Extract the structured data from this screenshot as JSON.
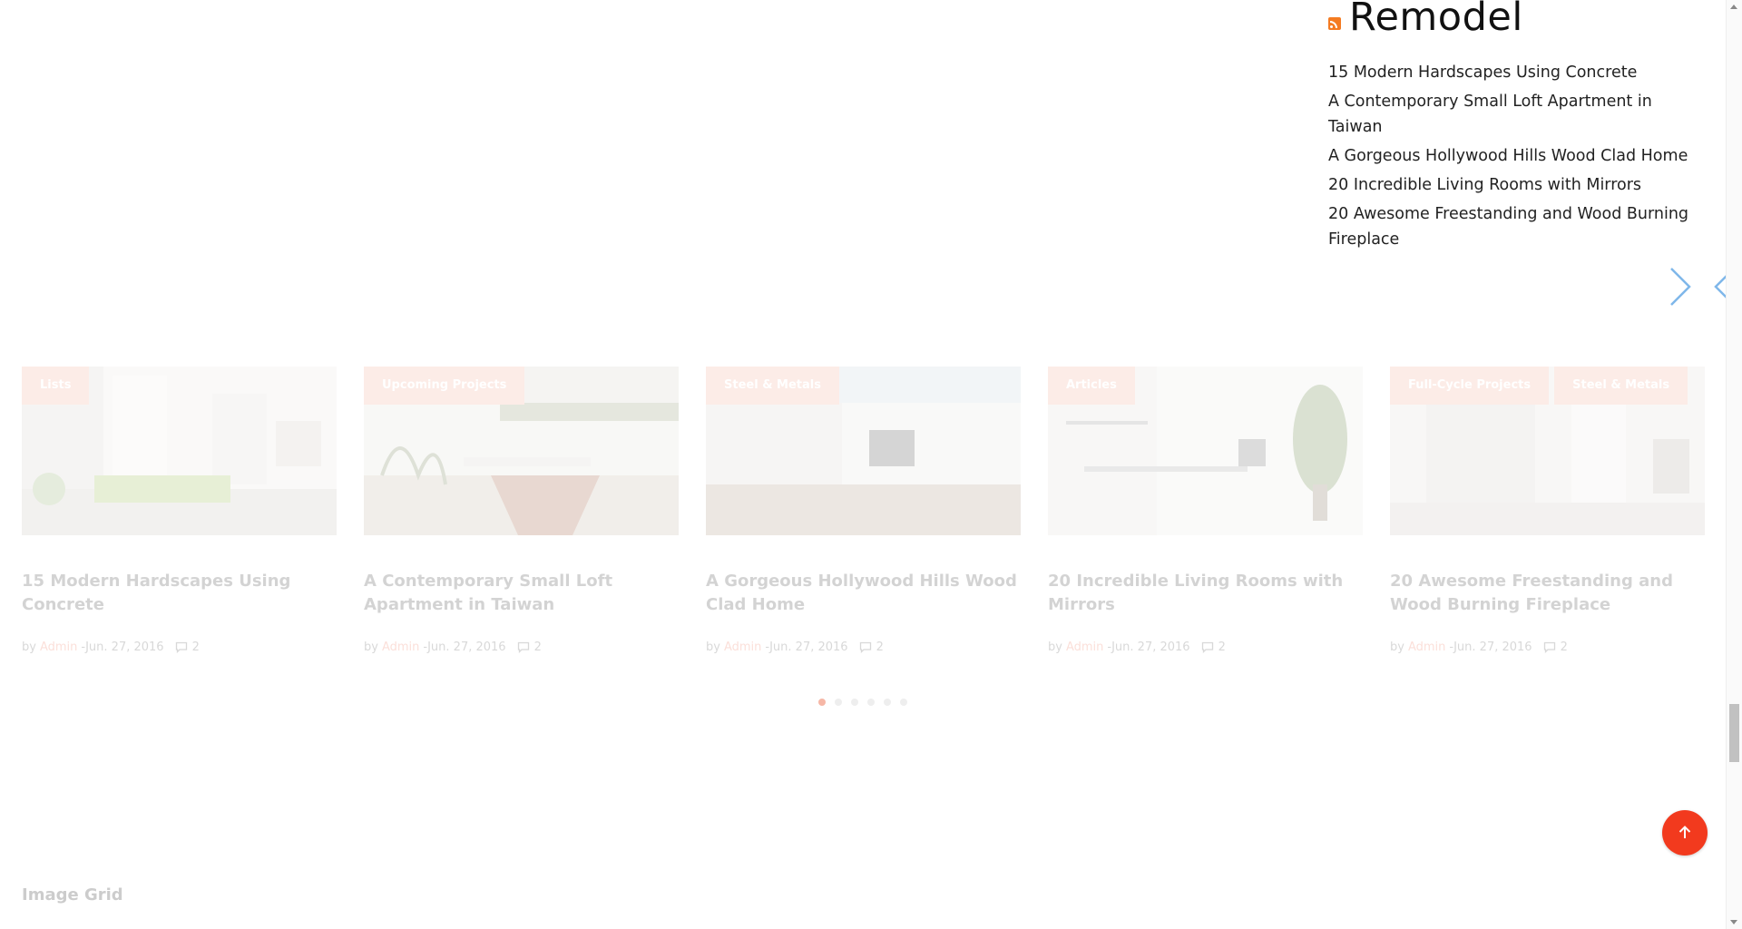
{
  "rss": {
    "heading": "Remodel",
    "items": [
      "15 Modern Hardscapes Using Concrete",
      "A Contemporary Small Loft Apartment in Taiwan",
      "A Gorgeous Hollywood Hills Wood Clad Home",
      "20 Incredible Living Rooms with Mirrors",
      "20 Awesome Freestanding and Wood Burning Fireplace"
    ]
  },
  "cards": [
    {
      "tags": [
        "Lists"
      ],
      "title": "15 Modern Hardscapes Using Concrete",
      "by": "by",
      "author": "Admin",
      "sep": " - ",
      "date": "Jun. 27, 2016",
      "comments": "2"
    },
    {
      "tags": [
        "Upcoming Projects"
      ],
      "title": "A Contemporary Small Loft Apartment in Taiwan",
      "by": "by",
      "author": "Admin",
      "sep": " - ",
      "date": "Jun. 27, 2016",
      "comments": "2"
    },
    {
      "tags": [
        "Steel & Metals"
      ],
      "title": "A Gorgeous Hollywood Hills Wood Clad Home",
      "by": "by",
      "author": "Admin",
      "sep": " - ",
      "date": "Jun. 27, 2016",
      "comments": "2"
    },
    {
      "tags": [
        "Articles"
      ],
      "title": "20 Incredible Living Rooms with Mirrors",
      "by": "by",
      "author": "Admin",
      "sep": " - ",
      "date": "Jun. 27, 2016",
      "comments": "2"
    },
    {
      "tags": [
        "Full-Cycle Projects",
        "Steel & Metals"
      ],
      "title": "20 Awesome Freestanding and Wood Burning Fireplace",
      "by": "by",
      "author": "Admin",
      "sep": " - ",
      "date": "Jun. 27, 2016",
      "comments": "2"
    }
  ],
  "section_label": "Image Grid",
  "colors": {
    "accent": "#f23a1e",
    "tag": "#f7b7a3",
    "arrow": "#7fb7ea"
  }
}
